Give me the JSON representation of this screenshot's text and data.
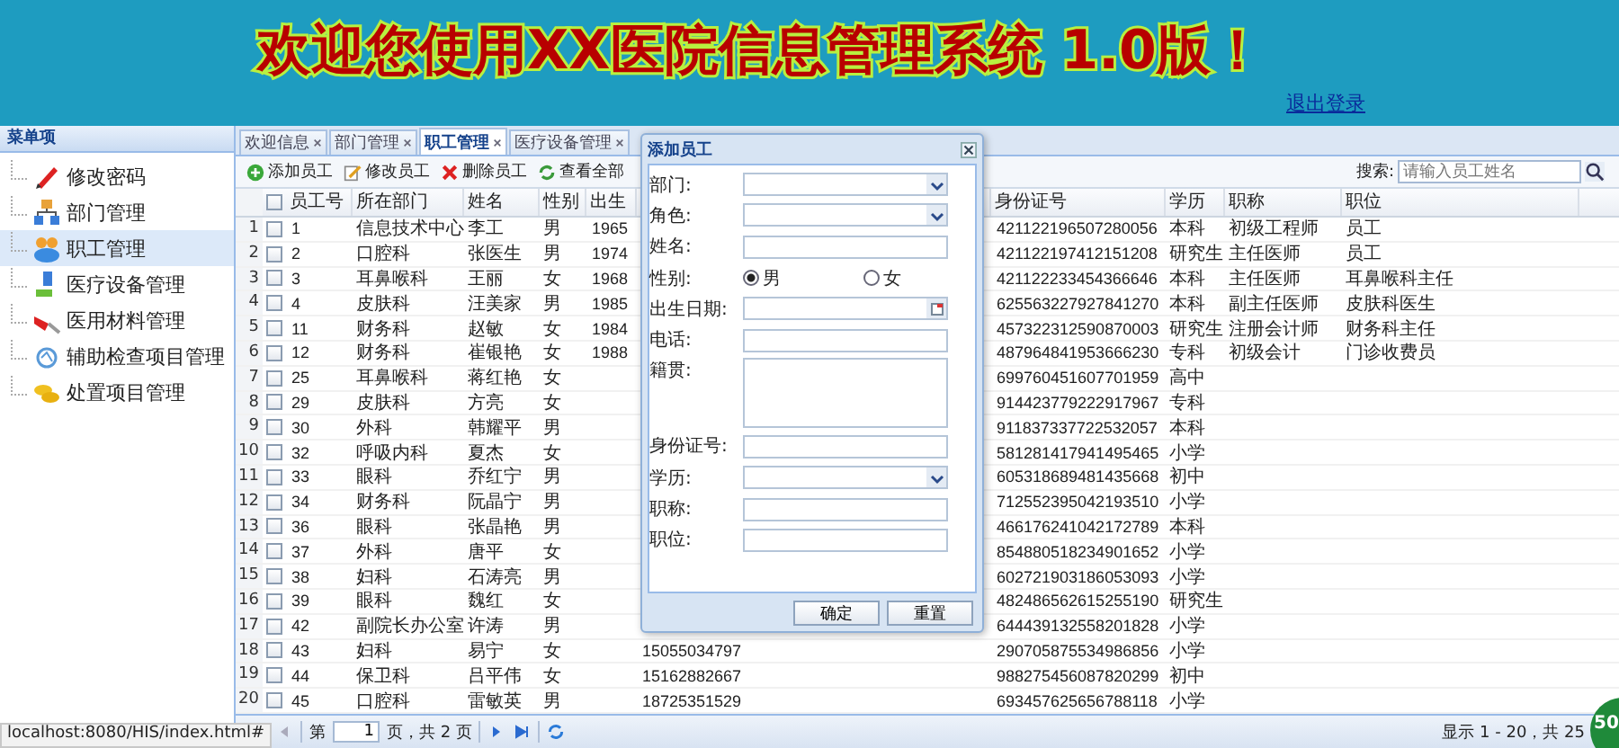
{
  "header": {
    "title": "欢迎您使用XX医院信息管理系统 1.0版！",
    "logout": "退出登录"
  },
  "sidebar": {
    "title": "菜单项",
    "items": [
      {
        "label": "修改密码",
        "selected": false
      },
      {
        "label": "部门管理",
        "selected": false
      },
      {
        "label": "职工管理",
        "selected": true
      },
      {
        "label": "医疗设备管理",
        "selected": false
      },
      {
        "label": "医用材料管理",
        "selected": false
      },
      {
        "label": "辅助检查项目管理",
        "selected": false
      },
      {
        "label": "处置项目管理",
        "selected": false
      }
    ]
  },
  "tabs": [
    {
      "label": "欢迎信息",
      "selected": false
    },
    {
      "label": "部门管理",
      "selected": false
    },
    {
      "label": "职工管理",
      "selected": true
    },
    {
      "label": "医疗设备管理",
      "selected": false
    }
  ],
  "toolbar": {
    "buttons": [
      "添加员工",
      "修改员工",
      "删除员工",
      "查看全部"
    ],
    "search_label": "搜索:",
    "search_placeholder": "请输入员工姓名"
  },
  "table": {
    "header_checked": false,
    "columns": [
      "员工号",
      "所在部门",
      "姓名",
      "性别",
      "出生",
      null,
      null,
      "身份证号",
      "学历",
      "职称",
      "职位"
    ],
    "rows": [
      {
        "n": "1",
        "checked": false,
        "id": "1",
        "dept": "信息技术中心",
        "name": "李工",
        "sex": "男",
        "birth": "1965",
        "idcard": "421122196507280056",
        "edu": "本科",
        "title": "初级工程师",
        "position": "员工"
      },
      {
        "n": "2",
        "checked": false,
        "id": "2",
        "dept": "口腔科",
        "name": "张医生",
        "sex": "男",
        "birth": "1974",
        "idcard": "421122197412151208",
        "edu": "研究生",
        "title": "主任医师",
        "position": "员工"
      },
      {
        "n": "3",
        "checked": false,
        "id": "3",
        "dept": "耳鼻喉科",
        "name": "王丽",
        "sex": "女",
        "birth": "1968",
        "idcard": "421122233454366646",
        "edu": "本科",
        "title": "主任医师",
        "position": "耳鼻喉科主任"
      },
      {
        "n": "4",
        "checked": false,
        "id": "4",
        "dept": "皮肤科",
        "name": "汪美家",
        "sex": "男",
        "birth": "1985",
        "idcard": "625563227927841270",
        "edu": "本科",
        "title": "副主任医师",
        "position": "皮肤科医生"
      },
      {
        "n": "5",
        "checked": false,
        "id": "11",
        "dept": "财务科",
        "name": "赵敏",
        "sex": "女",
        "birth": "1984",
        "idcard": "457322312590870003",
        "edu": "研究生",
        "title": "注册会计师",
        "position": "财务科主任"
      },
      {
        "n": "6",
        "checked": false,
        "id": "12",
        "dept": "财务科",
        "name": "崔银艳",
        "sex": "女",
        "birth": "1988",
        "idcard": "487964841953666230",
        "edu": "专科",
        "title": "初级会计",
        "position": "门诊收费员"
      },
      {
        "n": "7",
        "checked": false,
        "id": "25",
        "dept": "耳鼻喉科",
        "name": "蒋红艳",
        "sex": "女",
        "idcard": "699760451607701959",
        "edu": "高中"
      },
      {
        "n": "8",
        "checked": false,
        "id": "29",
        "dept": "皮肤科",
        "name": "方亮",
        "sex": "女",
        "idcard": "914423779222917967",
        "edu": "专科"
      },
      {
        "n": "9",
        "checked": false,
        "id": "30",
        "dept": "外科",
        "name": "韩耀平",
        "sex": "男",
        "idcard": "911837337722532057",
        "edu": "本科"
      },
      {
        "n": "10",
        "checked": false,
        "id": "32",
        "dept": "呼吸内科",
        "name": "夏杰",
        "sex": "女",
        "idcard": "581281417941495465",
        "edu": "小学"
      },
      {
        "n": "11",
        "checked": false,
        "id": "33",
        "dept": "眼科",
        "name": "乔红宁",
        "sex": "男",
        "idcard": "605318689481435668",
        "edu": "初中"
      },
      {
        "n": "12",
        "checked": false,
        "id": "34",
        "dept": "财务科",
        "name": "阮晶宁",
        "sex": "男",
        "idcard": "712552395042193510",
        "edu": "小学"
      },
      {
        "n": "13",
        "checked": false,
        "id": "36",
        "dept": "眼科",
        "name": "张晶艳",
        "sex": "男",
        "idcard": "466176241042172789",
        "edu": "本科"
      },
      {
        "n": "14",
        "checked": false,
        "id": "37",
        "dept": "外科",
        "name": "唐平",
        "sex": "女",
        "idcard": "854880518234901652",
        "edu": "小学"
      },
      {
        "n": "15",
        "checked": false,
        "id": "38",
        "dept": "妇科",
        "name": "石涛亮",
        "sex": "男",
        "idcard": "602721903186053093",
        "edu": "小学"
      },
      {
        "n": "16",
        "checked": false,
        "id": "39",
        "dept": "眼科",
        "name": "魏红",
        "sex": "女",
        "idcard": "482486562615255190",
        "edu": "研究生"
      },
      {
        "n": "17",
        "checked": false,
        "id": "42",
        "dept": "副院长办公室",
        "name": "许涛",
        "sex": "男",
        "idcard": "644439132558201828",
        "edu": "小学"
      },
      {
        "n": "18",
        "checked": false,
        "id": "43",
        "dept": "妇科",
        "name": "易宁",
        "sex": "女",
        "phone": "15055034797",
        "idcard": "290705875534986856",
        "edu": "小学"
      },
      {
        "n": "19",
        "checked": false,
        "id": "44",
        "dept": "保卫科",
        "name": "吕平伟",
        "sex": "女",
        "phone": "15162882667",
        "idcard": "988275456087820299",
        "edu": "初中"
      },
      {
        "n": "20",
        "checked": false,
        "id": "45",
        "dept": "口腔科",
        "name": "雷敏英",
        "sex": "男",
        "phone": "18725351529",
        "idcard": "693457625656788118",
        "edu": "小学"
      }
    ]
  },
  "pager": {
    "prefix": "第",
    "page": "1",
    "suffix": "页，共 2 页",
    "summary": "显示 1 - 20，共 25"
  },
  "dialog": {
    "title": "添加员工",
    "fields": [
      {
        "label": "部门:",
        "kind": "select"
      },
      {
        "label": "角色:",
        "kind": "select"
      },
      {
        "label": "姓名:",
        "kind": "text"
      },
      {
        "label": "性别:",
        "kind": "radio",
        "options": [
          {
            "label": "男",
            "selected": true
          },
          {
            "label": "女",
            "selected": false
          }
        ]
      },
      {
        "label": "出生日期:",
        "kind": "date"
      },
      {
        "label": "电话:",
        "kind": "text"
      },
      {
        "label": "籍贯:",
        "kind": "textarea"
      },
      {
        "label": "身份证号:",
        "kind": "text"
      },
      {
        "label": "学历:",
        "kind": "select"
      },
      {
        "label": "职称:",
        "kind": "text"
      },
      {
        "label": "职位:",
        "kind": "text"
      }
    ],
    "buttons": [
      "确定",
      "重置"
    ]
  },
  "status_bar": "localhost:8080/HIS/index.html#",
  "badge": "50"
}
